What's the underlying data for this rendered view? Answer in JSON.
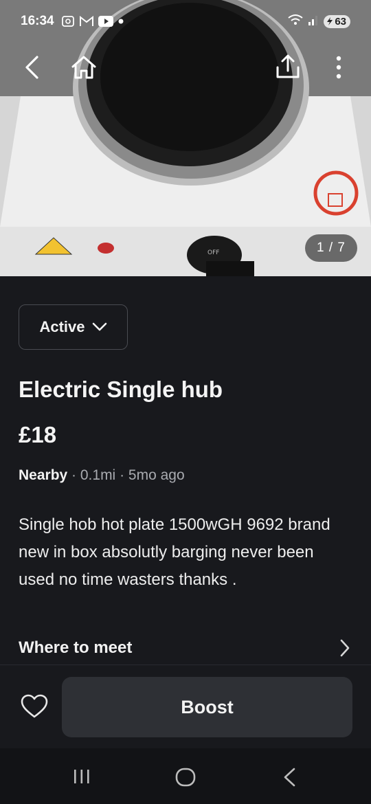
{
  "status_bar": {
    "time": "16:34",
    "battery": "63",
    "icons": [
      "screenshot-icon",
      "gmail-icon",
      "youtube-icon",
      "dot-icon",
      "wifi-icon",
      "signal-icon",
      "battery-icon"
    ]
  },
  "photo": {
    "counter": "1 / 7",
    "product_label": "OFF"
  },
  "nav": {
    "icons": [
      "back-icon",
      "home-icon",
      "share-icon",
      "more-icon"
    ]
  },
  "listing": {
    "status_label": "Active",
    "title": "Electric Single hub",
    "price": "£18",
    "location": "Nearby",
    "distance": "0.1mi",
    "posted": "5mo ago",
    "description": "Single hob hot plate 1500wGH 9692 brand new in box absolutly barging never been used no time wasters thanks .",
    "where_to_meet": "Where to meet"
  },
  "actions": {
    "boost_label": "Boost"
  },
  "colors": {
    "background": "#18191d",
    "button": "#2e3035",
    "text": "#f2f2f2",
    "muted": "#a9abb0"
  }
}
